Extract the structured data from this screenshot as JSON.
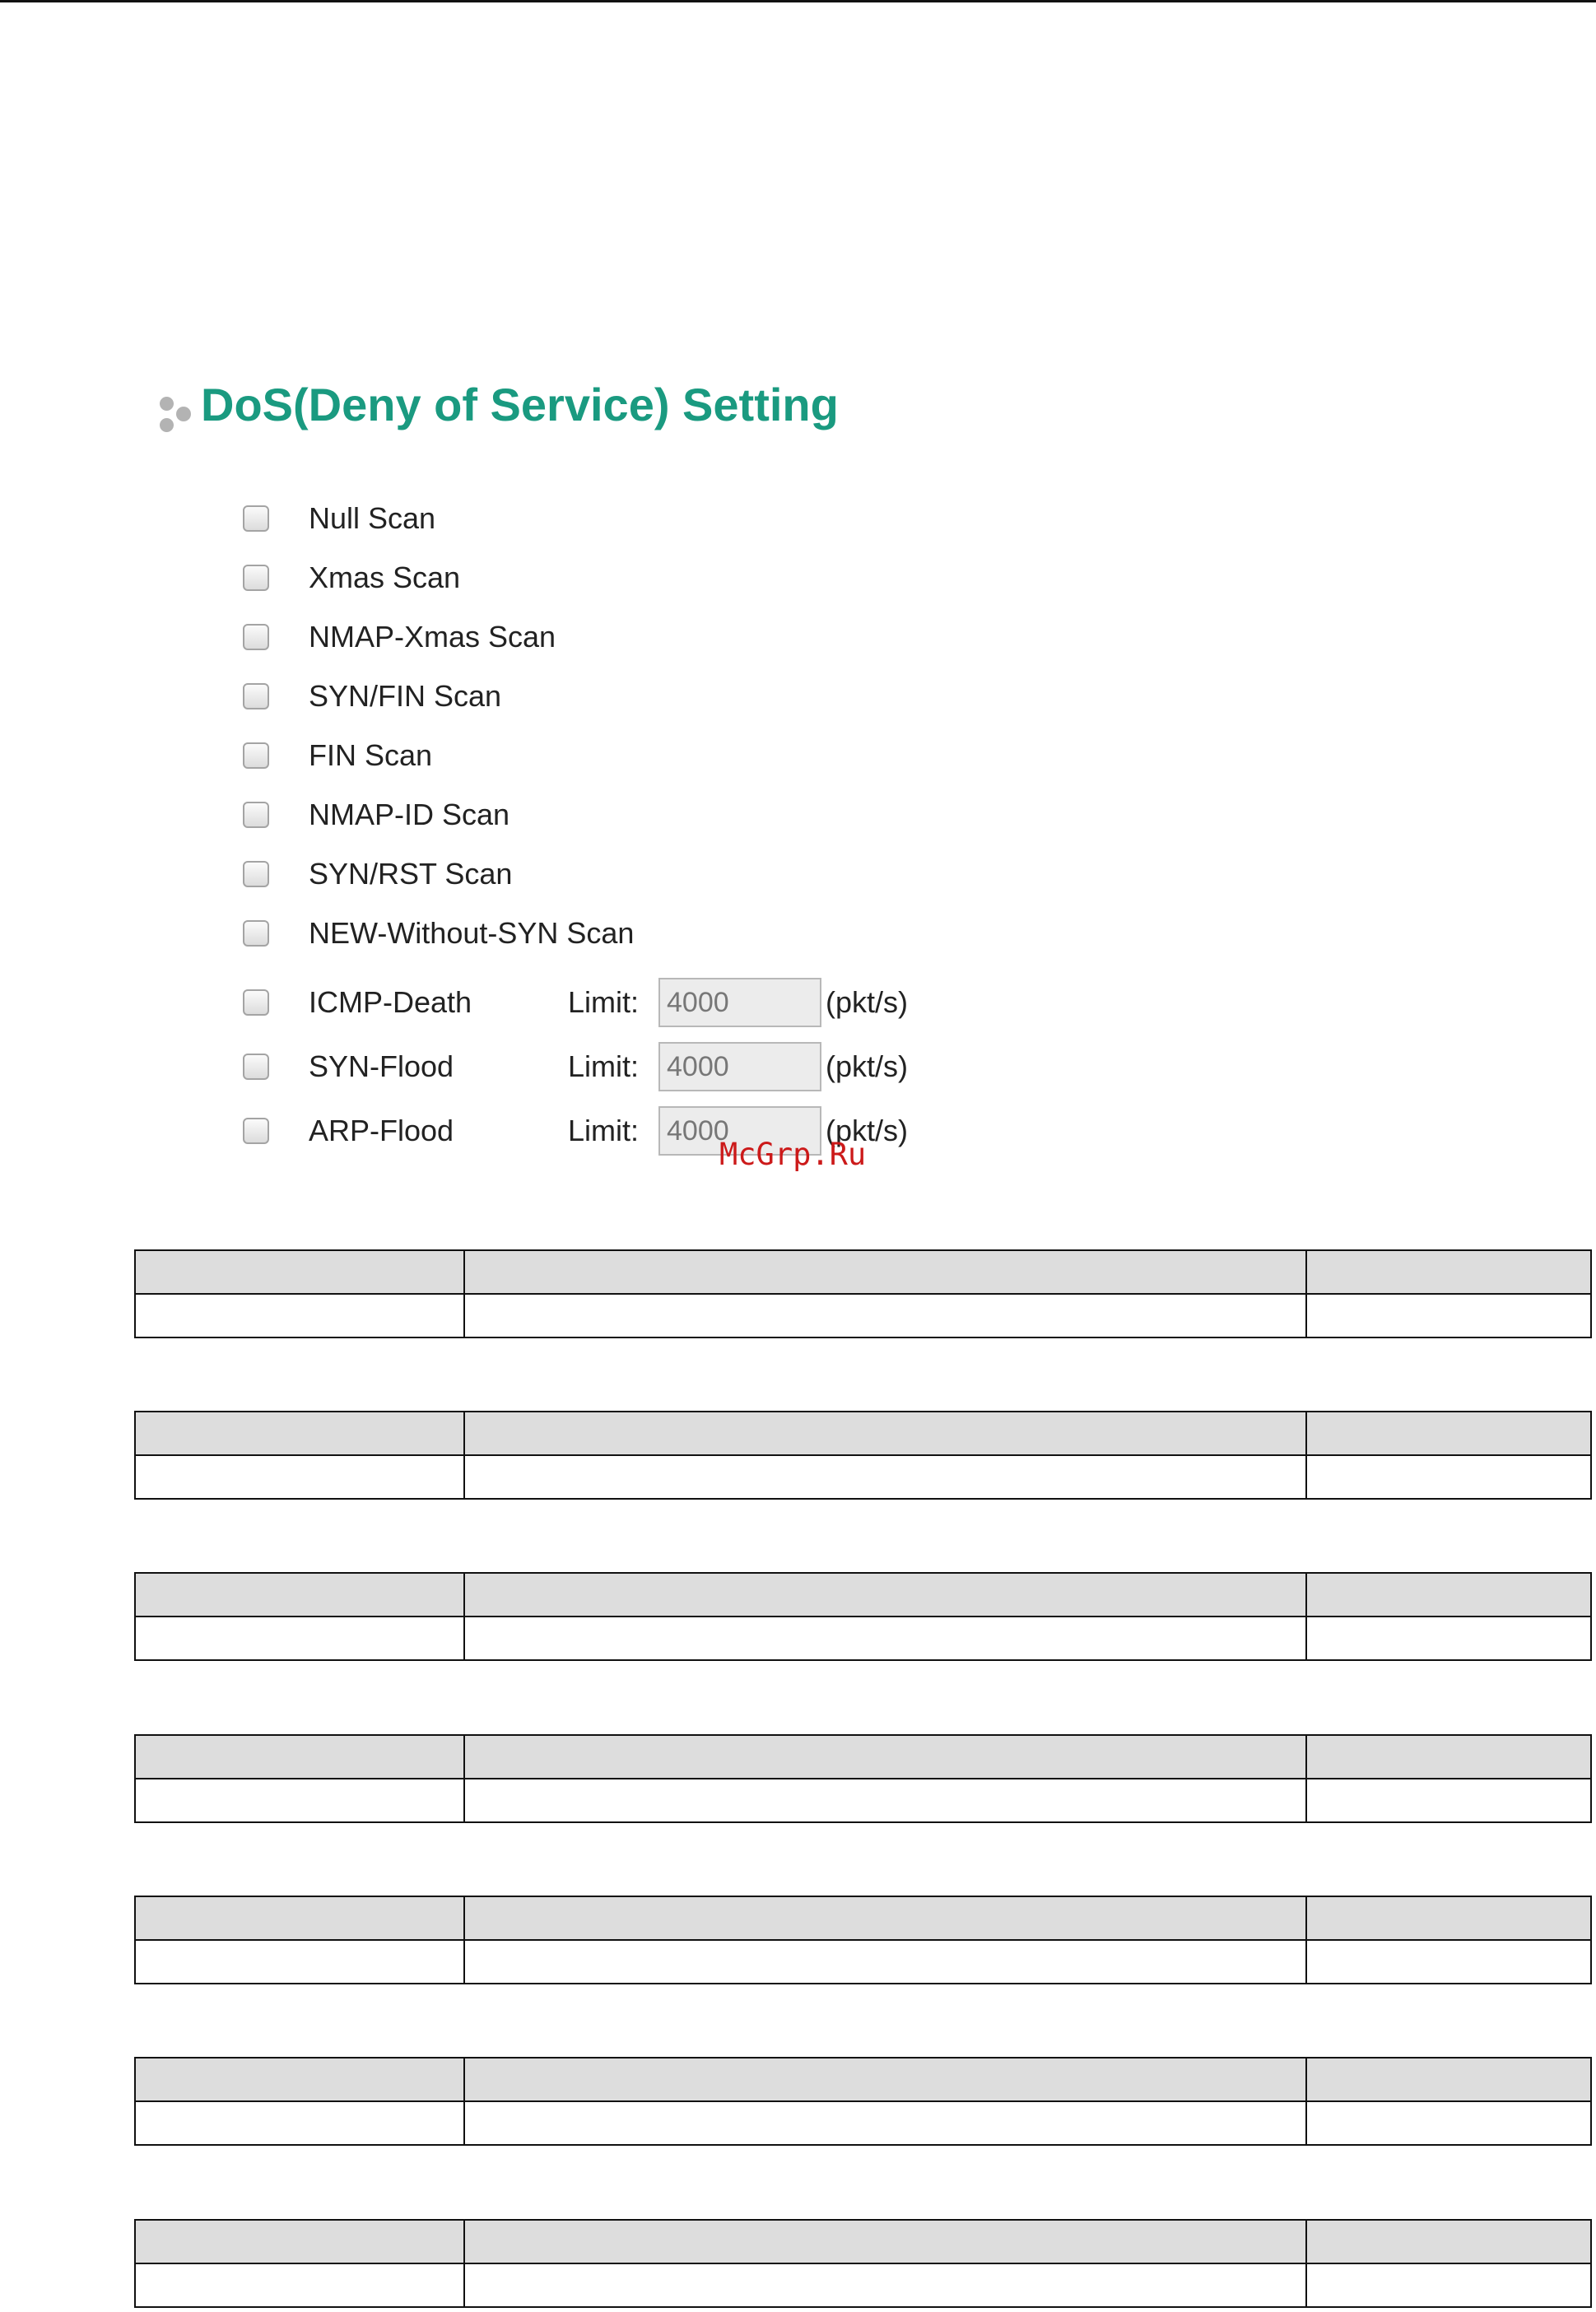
{
  "section": {
    "title": "DoS(Deny of Service) Setting"
  },
  "options": [
    {
      "label": "Null Scan"
    },
    {
      "label": "Xmas Scan"
    },
    {
      "label": "NMAP-Xmas Scan"
    },
    {
      "label": "SYN/FIN Scan"
    },
    {
      "label": "FIN Scan"
    },
    {
      "label": "NMAP-ID Scan"
    },
    {
      "label": "SYN/RST Scan"
    },
    {
      "label": "NEW-Without-SYN Scan"
    },
    {
      "label": "ICMP-Death",
      "limit_label": "Limit:",
      "limit_value": "4000",
      "unit": "(pkt/s)"
    },
    {
      "label": "SYN-Flood",
      "limit_label": "Limit:",
      "limit_value": "4000",
      "unit": "(pkt/s)"
    },
    {
      "label": "ARP-Flood",
      "limit_label": "Limit:",
      "limit_value": "4000",
      "unit": "(pkt/s)"
    }
  ],
  "watermark": "McGrp.Ru"
}
